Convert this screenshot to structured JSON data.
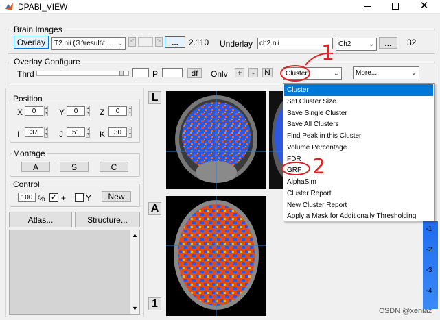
{
  "window": {
    "title": "DPABI_VIEW"
  },
  "brain_images": {
    "label": "Brain Images",
    "overlay_button": "Overlay",
    "overlay_file": "T2.nii (G:\\result\\t...",
    "prev_button": "<",
    "next_button": ">",
    "browse_button": "...",
    "overlay_value": "2.110",
    "underlay_label": "Underlay",
    "underlay_file": "ch2.nii",
    "underlay_template": "Ch2",
    "underlay_browse_button": "...",
    "underlay_value": "32"
  },
  "overlay_configure": {
    "label": "Overlay Configure",
    "thrd_label": "Thrd",
    "p_label": "P",
    "df_button": "df",
    "only_label": "Onlv",
    "plus_button": "+",
    "minus_button": "-",
    "n_button": "N",
    "cluster_select": "Cluster",
    "more_select": "More..."
  },
  "cluster_menu": {
    "items": [
      "Cluster",
      "Set Cluster Size",
      "Save Single Cluster",
      "Save All Clusters",
      "Find Peak in this Cluster",
      "Volume Percentage",
      "FDR",
      "GRF",
      "AlphaSim",
      "Cluster Report",
      "New Cluster Report",
      "Apply a Mask for Additionally Thresholding"
    ],
    "selected": "Cluster"
  },
  "position": {
    "label": "Position",
    "x_label": "X",
    "x_value": "0",
    "y_label": "Y",
    "y_value": "0",
    "z_label": "Z",
    "z_value": "0",
    "i_label": "I",
    "i_value": "37",
    "j_label": "J",
    "j_value": "51",
    "k_label": "K",
    "k_value": "30"
  },
  "montage": {
    "label": "Montage",
    "a_button": "A",
    "s_button": "S",
    "c_button": "C"
  },
  "control": {
    "label": "Control",
    "zoom_value": "100",
    "zoom_unit": "%",
    "plus_label": "+",
    "plus_checked": true,
    "y_label": "Y",
    "y_checked": false,
    "new_button": "New"
  },
  "buttons": {
    "atlas": "Atlas...",
    "structure": "Structure..."
  },
  "view_labels": {
    "l_button": "L",
    "a_button": "A",
    "one_button": "1"
  },
  "colorbar": {
    "ticks": [
      "-1",
      "-2",
      "-3",
      "-4"
    ]
  },
  "annotations": {
    "one": "1",
    "two": "2"
  },
  "watermark": "CSDN @xeniaz"
}
